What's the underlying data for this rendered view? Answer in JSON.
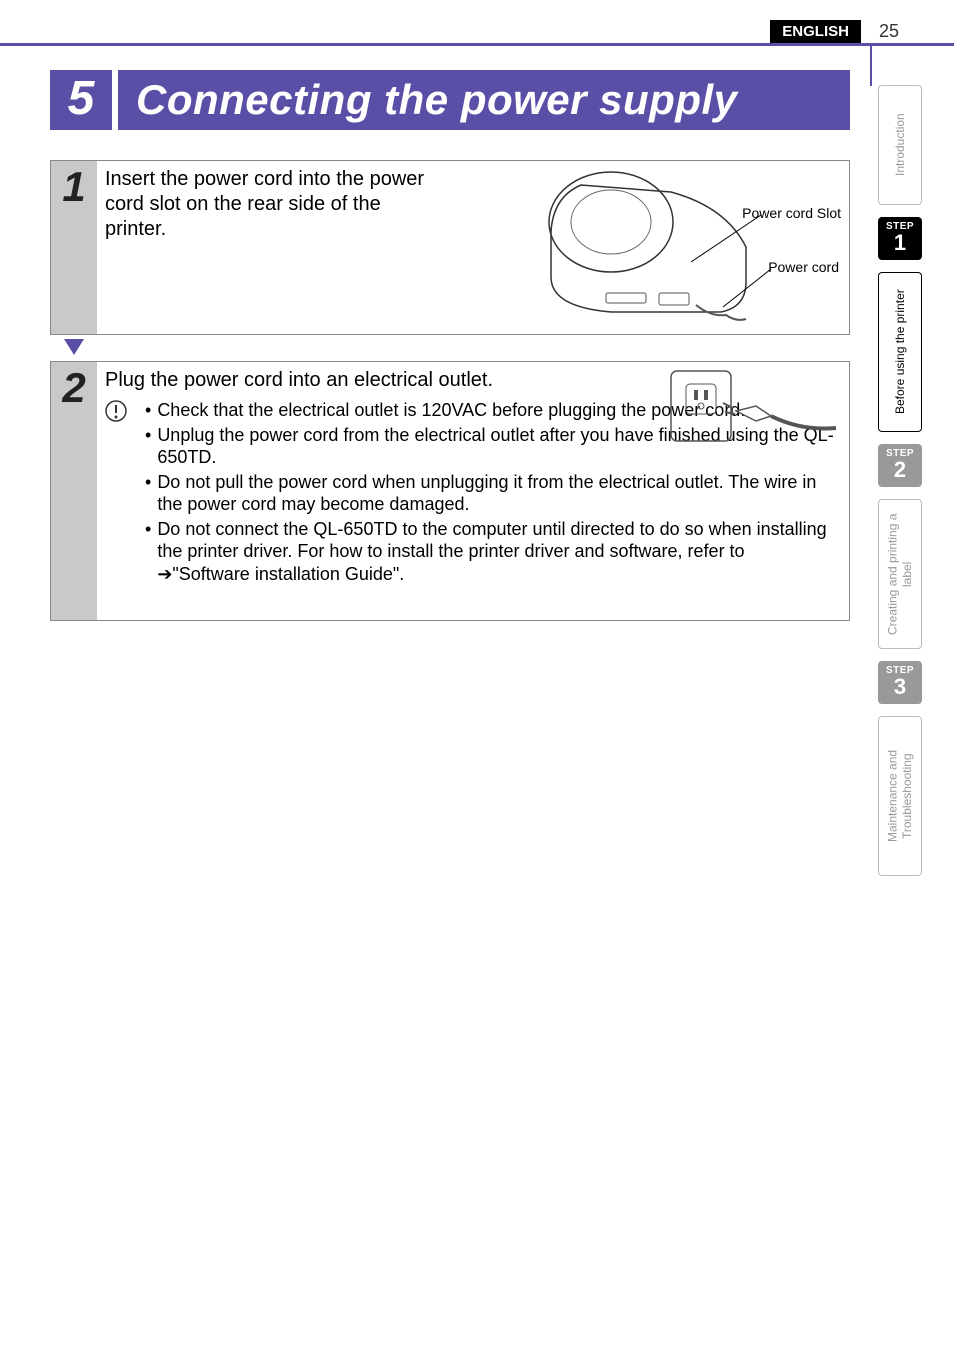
{
  "header": {
    "language": "ENGLISH",
    "page_number": "25"
  },
  "section": {
    "number": "5",
    "title": "Connecting the power supply"
  },
  "steps": [
    {
      "num": "1",
      "text": "Insert the power cord into the power cord slot on the rear side of the printer.",
      "callouts": {
        "slot": "Power cord Slot",
        "cord": "Power cord"
      }
    },
    {
      "num": "2",
      "text": "Plug the power cord into an electrical outlet.",
      "bullets": [
        "Check that the electrical outlet is 120VAC before plugging the power cord.",
        "Unplug the power cord from the electrical outlet after you have finished using the QL-650TD.",
        "Do not pull the power cord when unplugging it from the electrical outlet. The wire in the power cord may become damaged.",
        "Do not connect the QL-650TD to the computer until directed to do so when installing the printer driver. For how to install the printer driver and software, refer to ➔\"Software installation Guide\"."
      ]
    }
  ],
  "tabs": {
    "intro": "Introduction",
    "step1_label": "STEP",
    "step1_num": "1",
    "before": "Before using the printer",
    "step2_label": "STEP",
    "step2_num": "2",
    "creating": "Creating and printing a label",
    "step3_label": "STEP",
    "step3_num": "3",
    "maint": "Maintenance and Troubleshooting"
  }
}
